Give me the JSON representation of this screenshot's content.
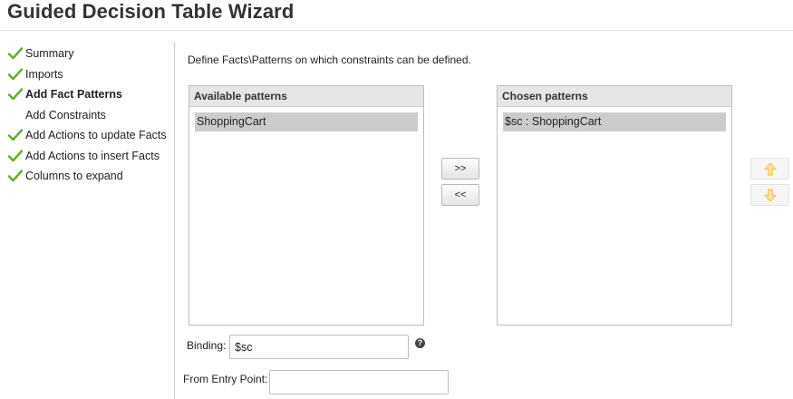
{
  "wizard": {
    "title": "Guided Decision Table Wizard",
    "steps": [
      {
        "label": "Summary",
        "complete": true,
        "active": false
      },
      {
        "label": "Imports",
        "complete": true,
        "active": false
      },
      {
        "label": "Add Fact Patterns",
        "complete": true,
        "active": true
      },
      {
        "label": "Add Constraints",
        "complete": false,
        "active": false
      },
      {
        "label": "Add Actions to update Facts",
        "complete": true,
        "active": false
      },
      {
        "label": "Add Actions to insert Facts",
        "complete": true,
        "active": false
      },
      {
        "label": "Columns to expand",
        "complete": true,
        "active": false
      }
    ]
  },
  "main": {
    "instruction": "Define Facts\\Patterns on which constraints can be defined.",
    "available": {
      "header": "Available patterns",
      "items": [
        "ShoppingCart"
      ]
    },
    "chosen": {
      "header": "Chosen patterns",
      "items": [
        "$sc : ShoppingCart"
      ]
    },
    "buttons": {
      "add": ">>",
      "remove": "<<"
    },
    "binding": {
      "label": "Binding:",
      "value": "$sc",
      "help": "?"
    },
    "entry_point": {
      "label": "From Entry Point:",
      "value": ""
    }
  },
  "colors": {
    "check": "#6aae2a",
    "selected_row": "#cccccc",
    "panel_header": "#e6e6e6",
    "arrow_icon": "#f5c451"
  }
}
